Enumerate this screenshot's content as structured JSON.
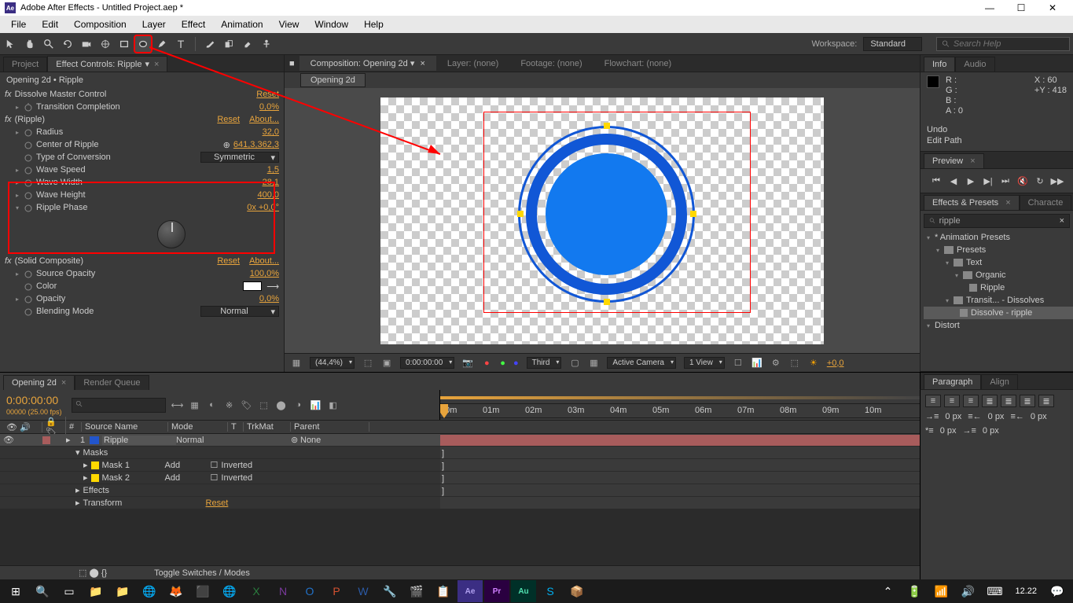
{
  "titlebar": {
    "title": "Adobe After Effects - Untitled Project.aep *"
  },
  "menubar": [
    "File",
    "Edit",
    "Composition",
    "Layer",
    "Effect",
    "Animation",
    "View",
    "Window",
    "Help"
  ],
  "workspace": {
    "label": "Workspace:",
    "value": "Standard"
  },
  "search": {
    "placeholder": "Search Help"
  },
  "left_tabs": {
    "project": "Project",
    "effect": "Effect Controls: Ripple"
  },
  "breadcrumb": "Opening 2d • Ripple",
  "fx": {
    "dissolve": {
      "header": "Dissolve Master Control",
      "reset": "Reset",
      "rows": [
        {
          "prop": "Transition Completion",
          "val": "0,0%"
        }
      ]
    },
    "ripple": {
      "header": "(Ripple)",
      "reset": "Reset",
      "about": "About...",
      "rows": [
        {
          "prop": "Radius",
          "val": "32,0"
        },
        {
          "prop": "Center of Ripple",
          "val": "641,3,362,3",
          "target": true
        },
        {
          "prop": "Type of Conversion",
          "val": "Symmetric",
          "dd": true
        },
        {
          "prop": "Wave Speed",
          "val": "1,5"
        },
        {
          "prop": "Wave Width",
          "val": "28,1"
        },
        {
          "prop": "Wave Height",
          "val": "400,0"
        },
        {
          "prop": "Ripple Phase",
          "val": "0x +0,0°"
        }
      ]
    },
    "solid": {
      "header": "(Solid Composite)",
      "reset": "Reset",
      "about": "About...",
      "rows": [
        {
          "prop": "Source Opacity",
          "val": "100,0%"
        },
        {
          "prop": "Color",
          "swatch": true
        },
        {
          "prop": "Opacity",
          "val": "0,0%"
        },
        {
          "prop": "Blending Mode",
          "val": "Normal",
          "dd": true
        }
      ]
    }
  },
  "comp": {
    "tabs": [
      {
        "label": "Composition: Opening 2d",
        "active": true
      },
      {
        "label": "Layer: (none)"
      },
      {
        "label": "Footage: (none)"
      },
      {
        "label": "Flowchart: (none)"
      }
    ],
    "inner_tab": "Opening 2d",
    "footer": {
      "zoom": "(44,4%)",
      "time": "0:00:00:00",
      "quality": "Third",
      "camera": "Active Camera",
      "view": "1 View",
      "exposure": "+0,0"
    }
  },
  "info": {
    "tab1": "Info",
    "tab2": "Audio",
    "R": "R :",
    "G": "G :",
    "B": "B :",
    "A": "A :  0",
    "X": "X : 60",
    "Y": "Y : 418",
    "undo": "Undo",
    "edit": "Edit Path"
  },
  "preview": {
    "label": "Preview"
  },
  "effects": {
    "tab1": "Effects & Presets",
    "tab2": "Characte",
    "search": "ripple",
    "tree": [
      {
        "label": "* Animation Presets",
        "lvl": 0,
        "star": true
      },
      {
        "label": "Presets",
        "lvl": 1,
        "folder": true
      },
      {
        "label": "Text",
        "lvl": 2,
        "folder": true
      },
      {
        "label": "Organic",
        "lvl": 3,
        "folder": true
      },
      {
        "label": "Ripple",
        "lvl": 4,
        "preset": true
      },
      {
        "label": "Transit... - Dissolves",
        "lvl": 2,
        "folder": true
      },
      {
        "label": "Dissolve - ripple",
        "lvl": 3,
        "preset": true,
        "highlight": true
      },
      {
        "label": "Distort",
        "lvl": 0
      }
    ]
  },
  "paragraph": {
    "tab1": "Paragraph",
    "tab2": "Align",
    "vals": [
      "0 px",
      "0 px",
      "0 px",
      "0 px"
    ]
  },
  "timeline": {
    "tabs": [
      {
        "label": "Opening 2d",
        "active": true
      },
      {
        "label": "Render Queue"
      }
    ],
    "timecode": "0:00:00:00",
    "sub": "00000 (25.00 fps)",
    "cols": [
      "#",
      "Source Name",
      "Mode",
      "T",
      "TrkMat",
      "Parent"
    ],
    "ruler": [
      "00m",
      "01m",
      "02m",
      "03m",
      "04m",
      "05m",
      "06m",
      "07m",
      "08m",
      "09m",
      "10m"
    ],
    "rows": [
      {
        "num": "1",
        "name": "Ripple",
        "mode": "Normal",
        "parent": "None",
        "layer": true
      },
      {
        "name": "Masks",
        "indent": 1
      },
      {
        "name": "Mask 1",
        "indent": 2,
        "mask": true,
        "mode": "Add",
        "inv": "Inverted"
      },
      {
        "name": "Mask 2",
        "indent": 2,
        "mask": true,
        "mode": "Add",
        "inv": "Inverted"
      },
      {
        "name": "Effects",
        "indent": 1
      },
      {
        "name": "Transform",
        "indent": 1,
        "reset": "Reset"
      }
    ],
    "footer": "Toggle Switches / Modes"
  },
  "taskbar": {
    "time": "12.22"
  }
}
